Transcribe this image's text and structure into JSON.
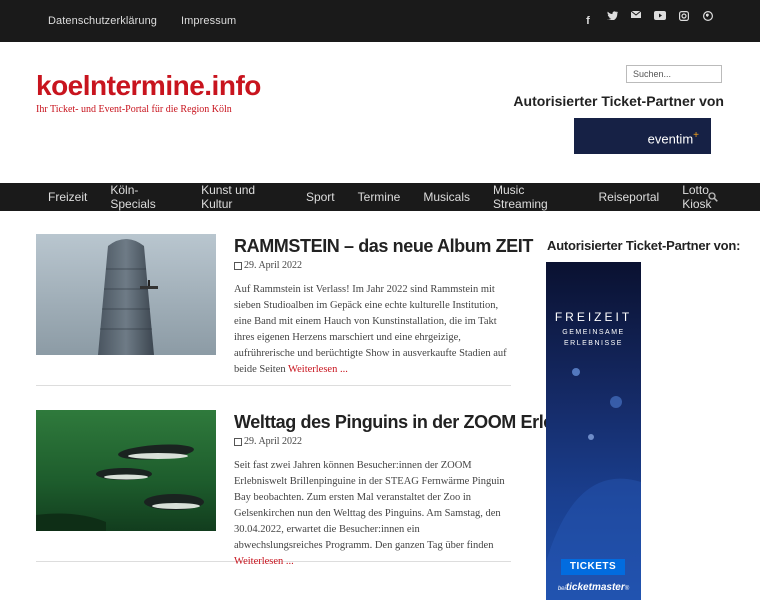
{
  "topnav": {
    "items": [
      "Datenschutzerklärung",
      "Impressum"
    ]
  },
  "social": [
    "facebook-icon",
    "twitter-icon",
    "mail-icon",
    "youtube-icon",
    "instagram-icon",
    "globe-icon"
  ],
  "site": {
    "title": "koelntermine.info",
    "tagline": "Ihr Ticket- und Event-Portal für die Region Köln"
  },
  "search": {
    "placeholder": "Suchen..."
  },
  "partner": {
    "heading": "Autorisierter Ticket-Partner von",
    "logo_text": "eventim"
  },
  "mainnav": [
    "Freizeit",
    "Köln-Specials",
    "Kunst und Kultur",
    "Sport",
    "Termine",
    "Musicals",
    "Music Streaming",
    "Reiseportal",
    "Lotto Kiosk"
  ],
  "posts": [
    {
      "title": "RAMMSTEIN – das neue Album ZEIT",
      "date": "29. April 2022",
      "excerpt": "Auf Rammstein ist Verlass! Im Jahr 2022 sind Rammstein mit sieben Studioalben im Gepäck eine echte kulturelle Institution, eine Band mit einem Hauch von Kunstinstallation, die im Takt ihres eigenen Herzens marschiert und eine ehrgeizige, aufrührerische und berüchtigte Show in ausverkaufte Stadien auf beide Seiten",
      "more": "Weiterlesen ..."
    },
    {
      "title": "Welttag des Pinguins in der ZOOM Erlebniswelt",
      "date": "29. April 2022",
      "excerpt": "Seit fast zwei Jahren können Besucher:innen der ZOOM Erlebniswelt Brillenpinguine in der STEAG Fernwärme Pinguin Bay beobachten. Zum ersten Mal veranstaltet der Zoo in Gelsenkirchen nun den Welttag des Pinguins. Am Samstag, den 30.04.2022, erwartet die Besucher:innen ein abwechslungsreiches Programm. Den ganzen Tag über finden",
      "more": "Weiterlesen ..."
    }
  ],
  "sidebar": {
    "heading": "Autorisierter Ticket-Partner von:",
    "banner": {
      "title": "FREIZEIT",
      "subtitle1": "GEMEINSAME",
      "subtitle2": "ERLEBNISSE",
      "button": "TICKETS",
      "by": "bei",
      "brand": "ticketmaster",
      "reg": "®"
    }
  },
  "colors": {
    "brand": "#c8141e",
    "dark_bar": "#1a1a1a",
    "eventim_bg": "#162145",
    "ticket_blue": "#026cdf"
  }
}
